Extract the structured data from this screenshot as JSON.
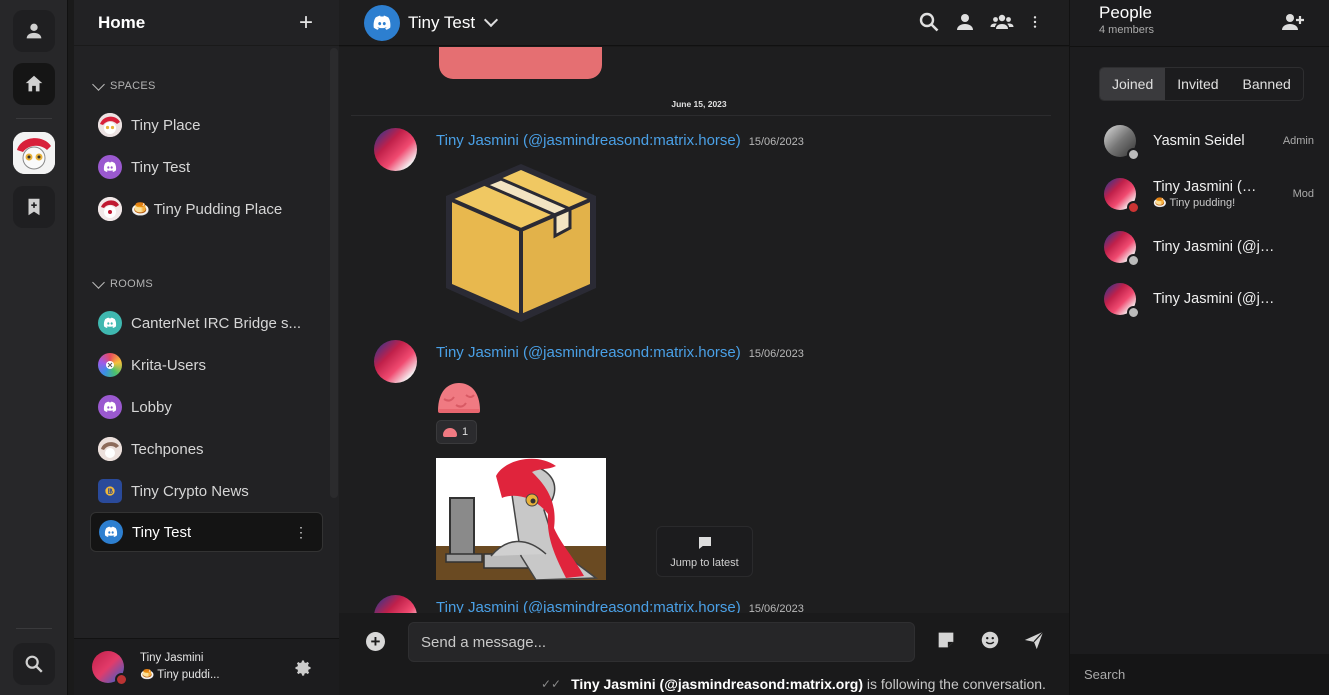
{
  "sidebar": {
    "title": "Home",
    "spaces_label": "SPACES",
    "rooms_label": "ROOMS",
    "spaces": [
      {
        "label": "Tiny Place",
        "icon": "pony-avatar"
      },
      {
        "label": "Tiny Test",
        "icon": "discord-icon"
      },
      {
        "label": "🍮 Tiny Pudding Place",
        "icon": "pony-avatar"
      }
    ],
    "rooms": [
      {
        "label": "CanterNet IRC Bridge s...",
        "icon": "discord-icon"
      },
      {
        "label": "Krita-Users",
        "icon": "krita-icon"
      },
      {
        "label": "Lobby",
        "icon": "discord-icon"
      },
      {
        "label": "Techpones",
        "icon": "pony-avatar"
      },
      {
        "label": "Tiny Crypto News",
        "icon": "crypto-icon"
      },
      {
        "label": "Tiny Test",
        "icon": "discord-icon",
        "selected": true
      }
    ],
    "user": {
      "name": "Tiny Jasmini",
      "status": "🍮 Tiny puddi..."
    }
  },
  "header": {
    "room_name": "Tiny Test"
  },
  "timeline": {
    "date_separator": "June 15, 2023",
    "messages": [
      {
        "sender": "Tiny Jasmini (@jasmindreasond:matrix.horse)",
        "time": "15/06/2023",
        "content": "package-sticker"
      },
      {
        "sender": "Tiny Jasmini (@jasmindreasond:matrix.horse)",
        "time": "15/06/2023",
        "content": "pudding-emoji",
        "reaction_count": "1"
      },
      {
        "sender": "Tiny Jasmini (@jasmindreasond:matrix.horse)",
        "time": "15/06/2023"
      }
    ],
    "jump_label": "Jump to latest"
  },
  "composer": {
    "placeholder": "Send a message...",
    "typing_user": "Tiny Jasmini (@jasmindreasond:matrix.org)",
    "typing_suffix": "is following the conversation."
  },
  "people": {
    "title": "People",
    "count": "4 members",
    "tabs": [
      "Joined",
      "Invited",
      "Banned"
    ],
    "active_tab": "Joined",
    "members": [
      {
        "name": "Yasmin Seidel",
        "role": "Admin",
        "status": ""
      },
      {
        "name": "Tiny Jasmini (@jasmindreasond:matrix.horse)",
        "role": "Mod",
        "status": "🍮 Tiny pudding!"
      },
      {
        "name": "Tiny Jasmini (@jasmindreasond:matrix.org)",
        "role": "",
        "status": ""
      },
      {
        "name": "Tiny Jasmini (@jasmindreasond)",
        "role": "",
        "status": ""
      }
    ],
    "search_placeholder": "Search"
  }
}
